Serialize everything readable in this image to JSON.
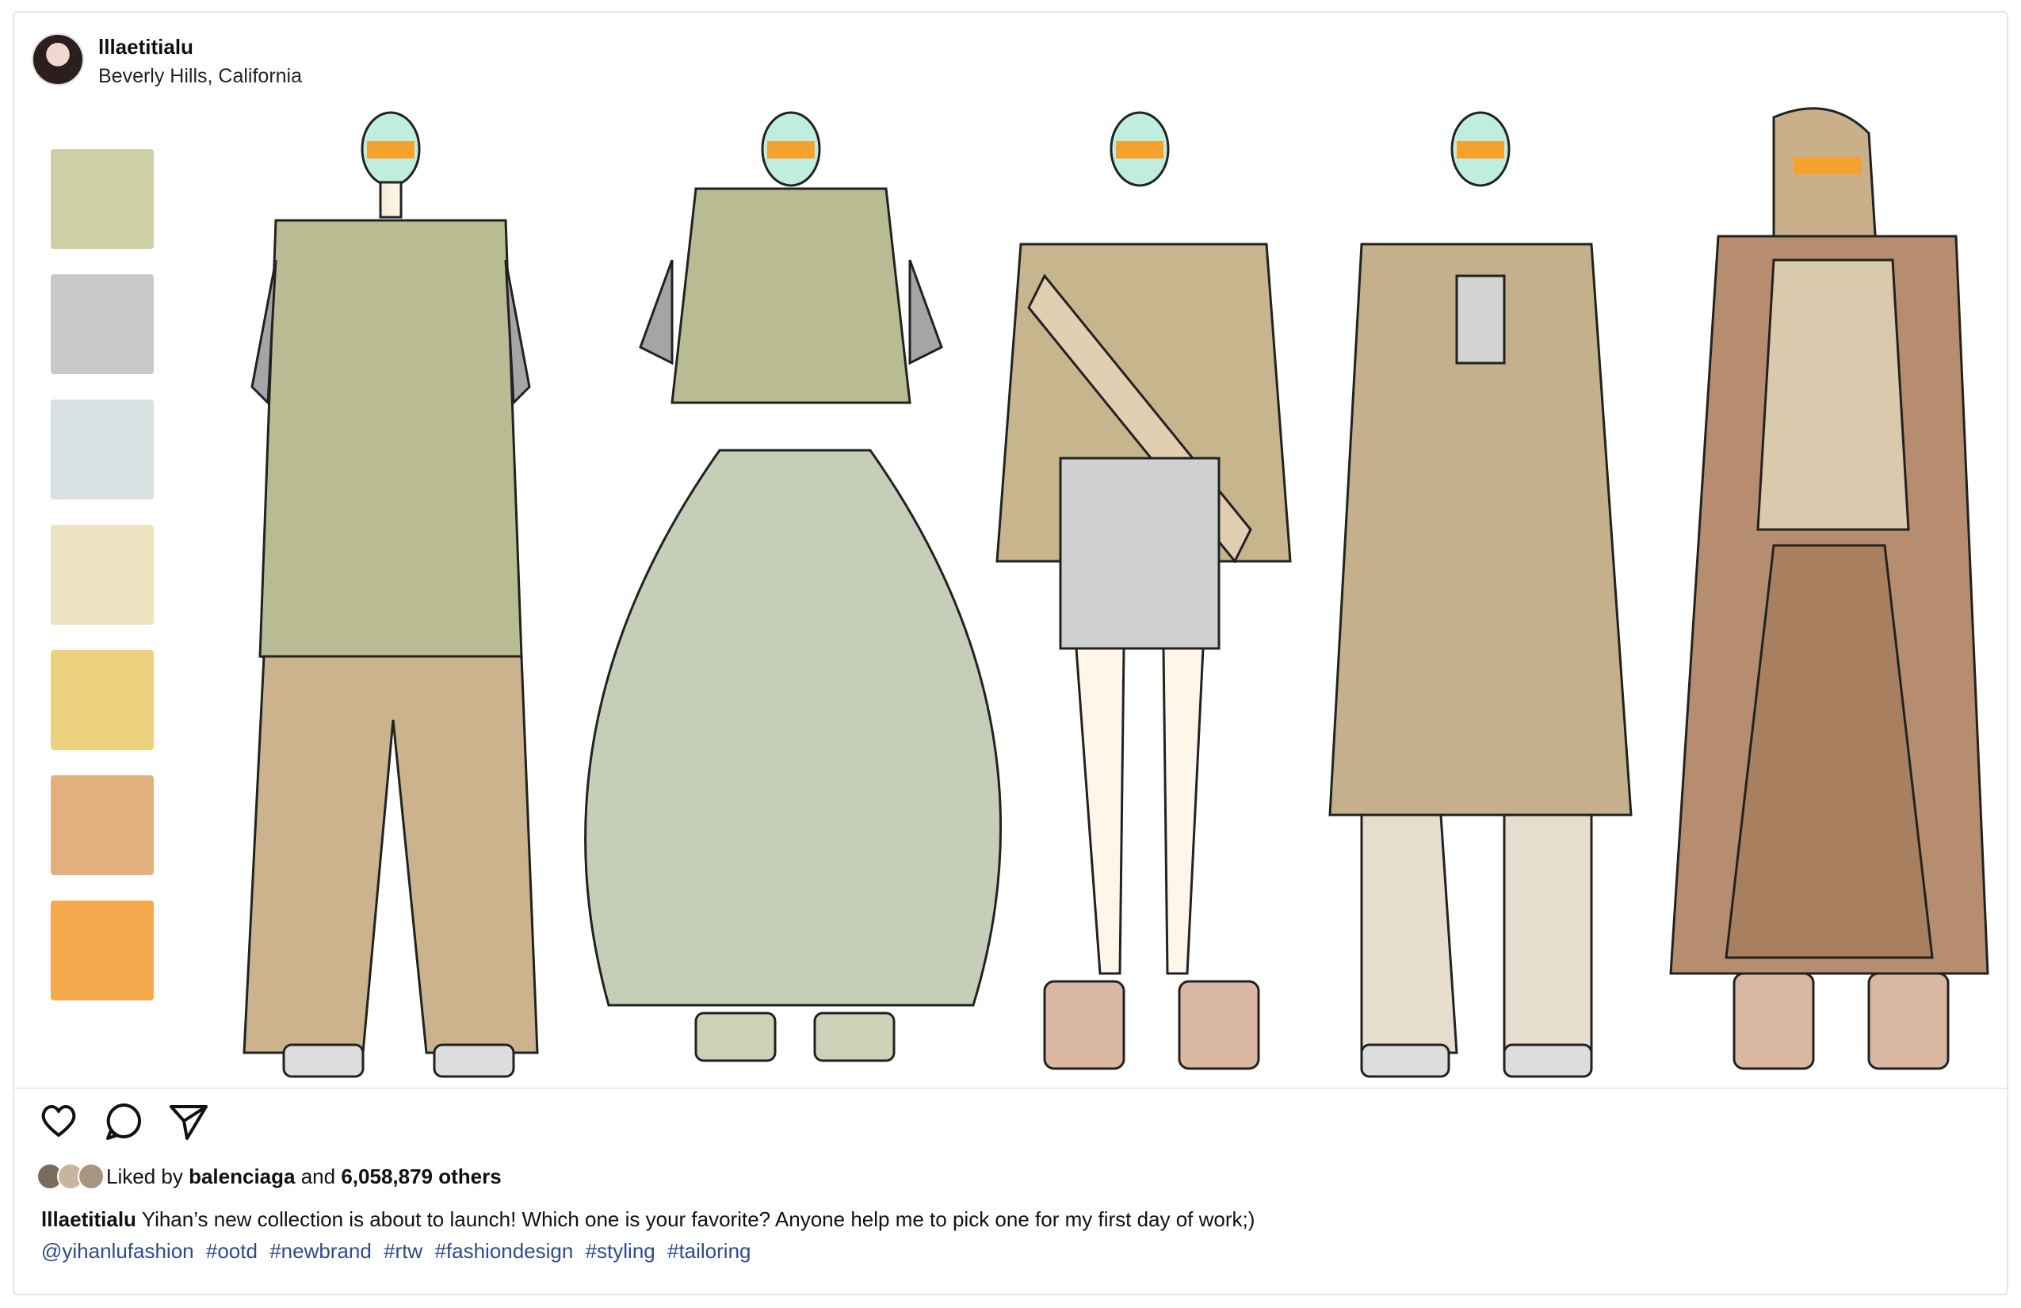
{
  "header": {
    "username": "lllaetitialu",
    "location": "Beverly Hills, California"
  },
  "swatches": [
    "#cfcfa6",
    "#c9c9c9",
    "#d8e1e2",
    "#ece3c3",
    "#ecd27e",
    "#e2b07d",
    "#f4a94c"
  ],
  "actions": {
    "like": "heart-icon",
    "comment": "comment-icon",
    "share": "send-icon"
  },
  "likes": {
    "prefix": "Liked by",
    "user": "balenciaga",
    "middle": "and",
    "count": "6,058,879 others"
  },
  "caption": {
    "username": "lllaetitialu",
    "text": "Yihan’s new collection is about to launch! Which one is your favorite? Anyone help me to pick one for my first day of work;)",
    "mention": "@yihanlufashion",
    "hashtags": [
      "#ootd",
      "#newbrand",
      "#rtw",
      "#fashiondesign",
      "#styling",
      "#tailoring"
    ]
  }
}
